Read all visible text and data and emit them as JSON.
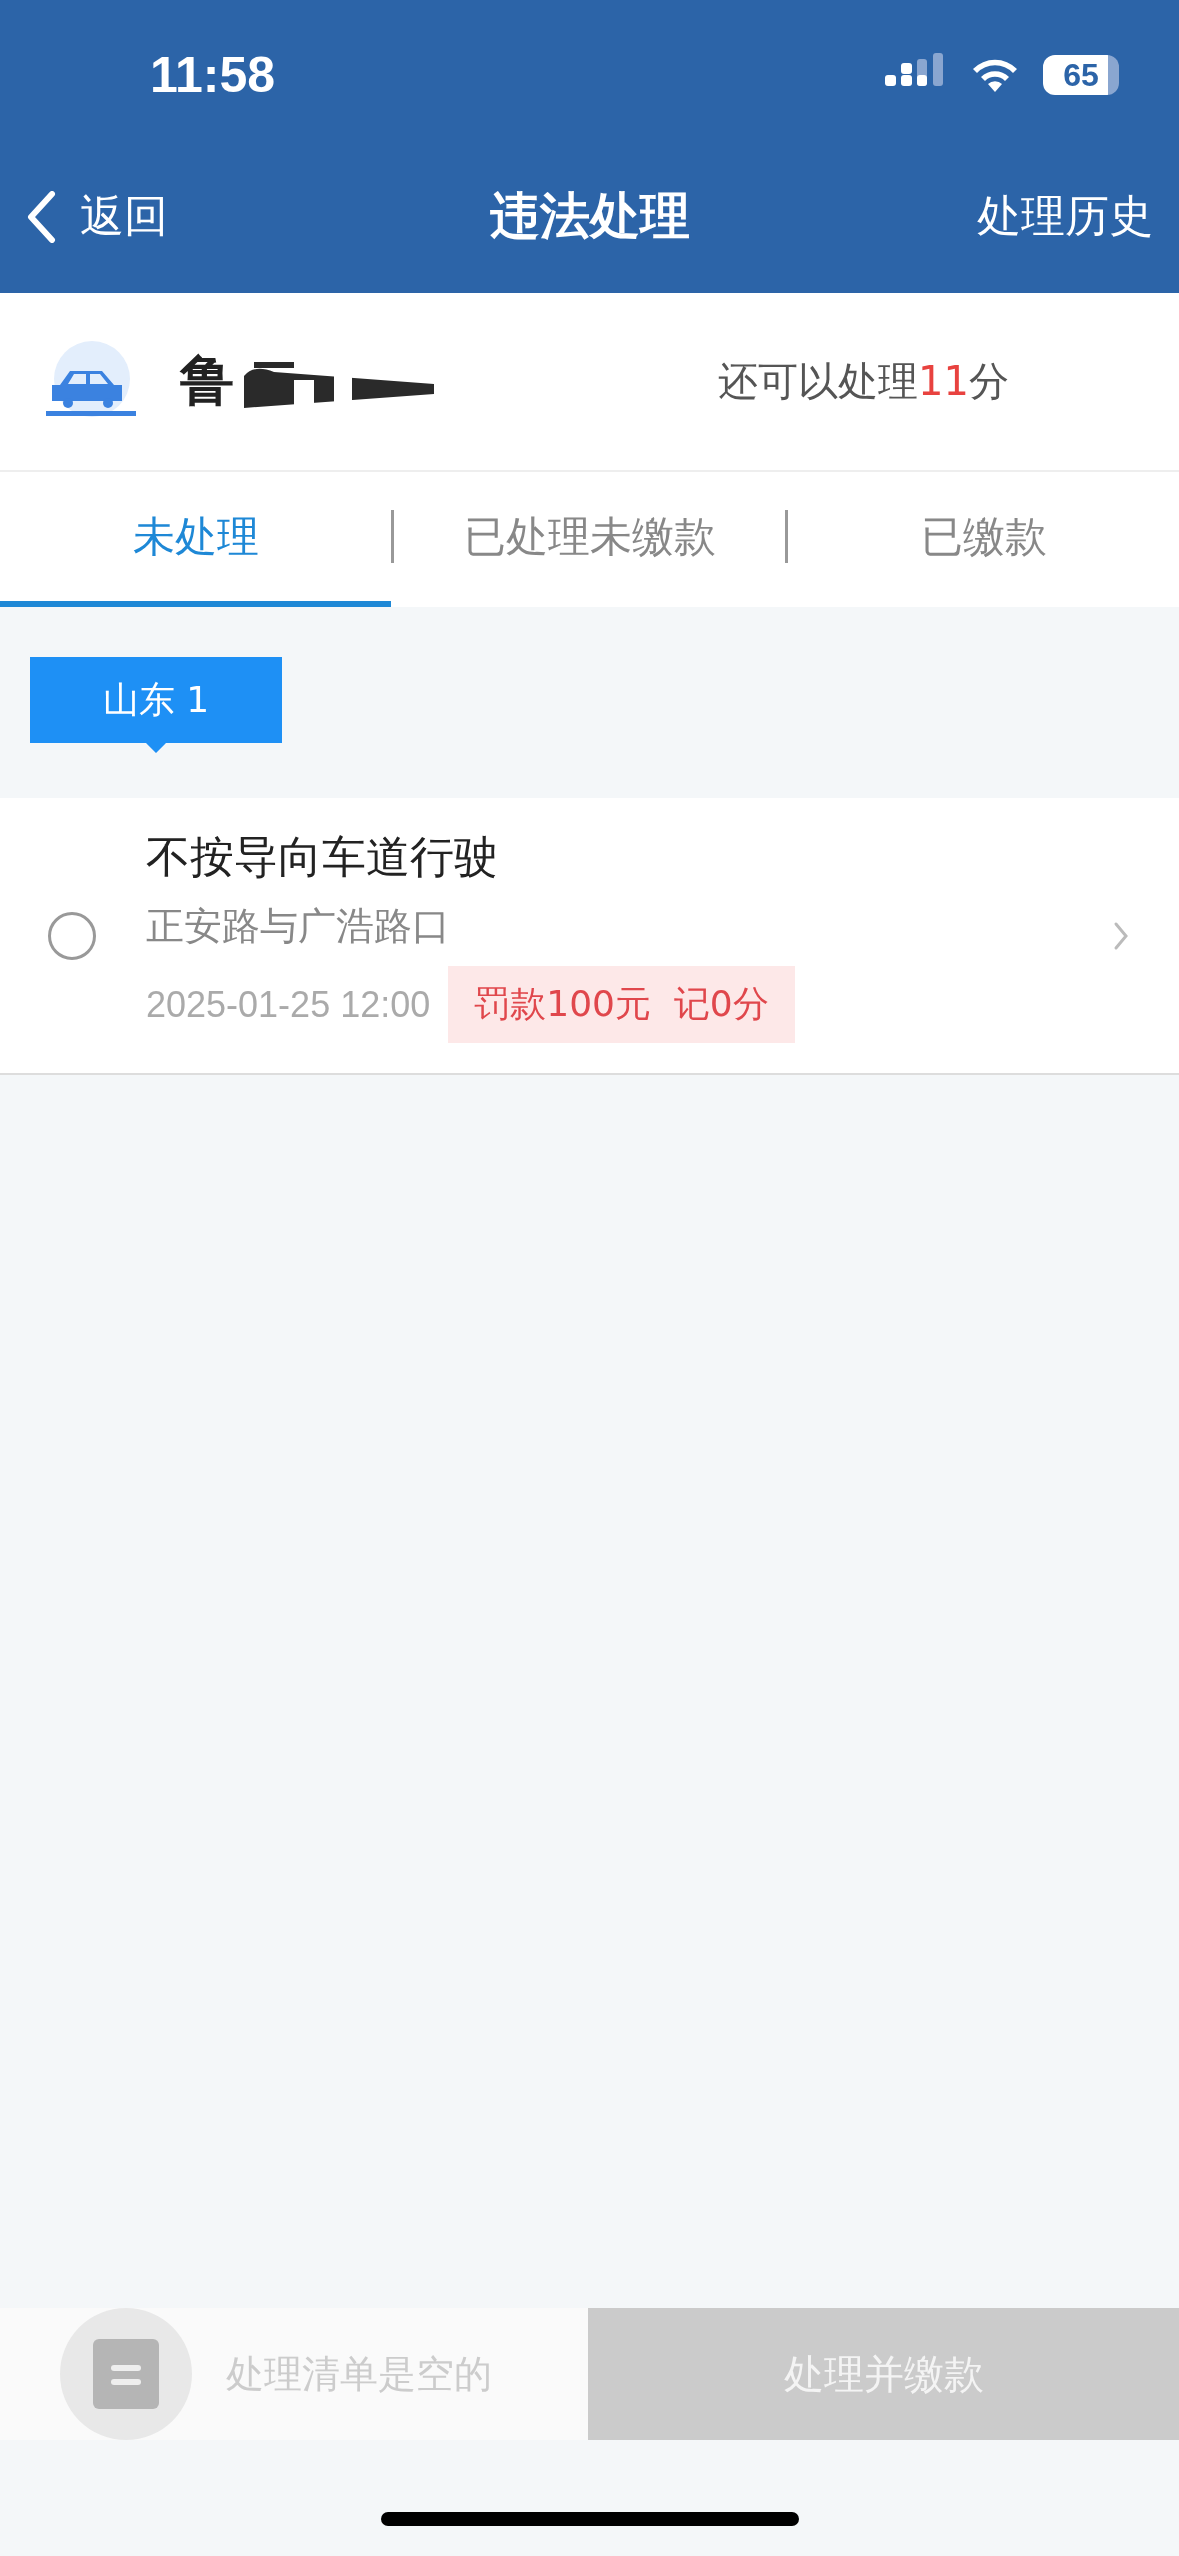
{
  "status_bar": {
    "time": "11:58",
    "battery": "65"
  },
  "nav": {
    "back": "返回",
    "title": "违法处理",
    "action": "处理历史"
  },
  "vehicle": {
    "plate": "鲁",
    "points_prefix": "还可以处理",
    "points": "11",
    "points_suffix": "分"
  },
  "tabs": [
    {
      "label": "未处理",
      "selected": true
    },
    {
      "label": "已处理未缴款",
      "selected": false
    },
    {
      "label": "已缴款",
      "selected": false
    }
  ],
  "region_tag": "山东 1",
  "violations": [
    {
      "title": "不按导向车道行驶",
      "location": "正安路与广浩路口",
      "time": "2025-01-25 12:00",
      "penalty": "罚款100元  记0分",
      "checked": false
    }
  ],
  "bottom_bar": {
    "cart_text": "处理清单是空的",
    "button": "处理并缴款",
    "disabled": true
  }
}
